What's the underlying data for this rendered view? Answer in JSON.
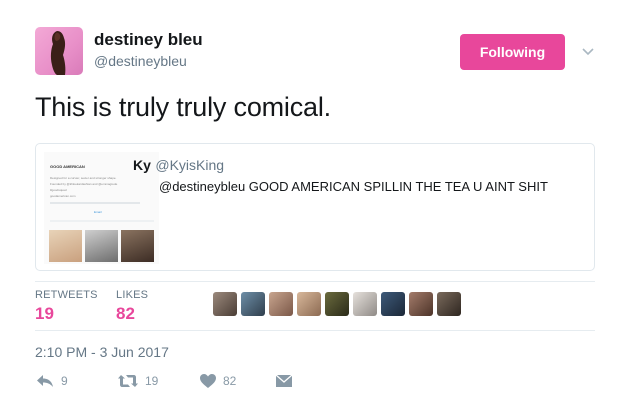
{
  "author": {
    "display_name": "destiney bleu",
    "handle": "@destineybleu"
  },
  "follow_button": {
    "label": "Following"
  },
  "tweet": {
    "text": "This is truly truly comical."
  },
  "quoted_tweet": {
    "name": "Ky",
    "handle": "@KyisKing",
    "text": "@destineybleu GOOD AMERICAN SPILLIN THE TEA U AINT SHIT",
    "thumbnail": {
      "title": "GOOD AMERICAN",
      "line1": "Designed for a curvier, sexier and stronger shape.",
      "line2": "Founded by @khloekardashian and @emmagrede",
      "line3": "#goodsquad",
      "line4": "goodamerican.com",
      "action": "Email"
    }
  },
  "stats": {
    "retweets_label": "RETWEETS",
    "retweets_count": "19",
    "likes_label": "LIKES",
    "likes_count": "82"
  },
  "timestamp": "2:10 PM - 3 Jun 2017",
  "actions": {
    "reply_count": "9",
    "retweet_count": "19",
    "like_count": "82"
  },
  "colors": {
    "accent": "#e8479b",
    "muted": "#657786",
    "icon": "#8899a6"
  },
  "icons": [
    "chevron-down-icon",
    "reply-icon",
    "retweet-icon",
    "heart-icon",
    "message-icon"
  ]
}
